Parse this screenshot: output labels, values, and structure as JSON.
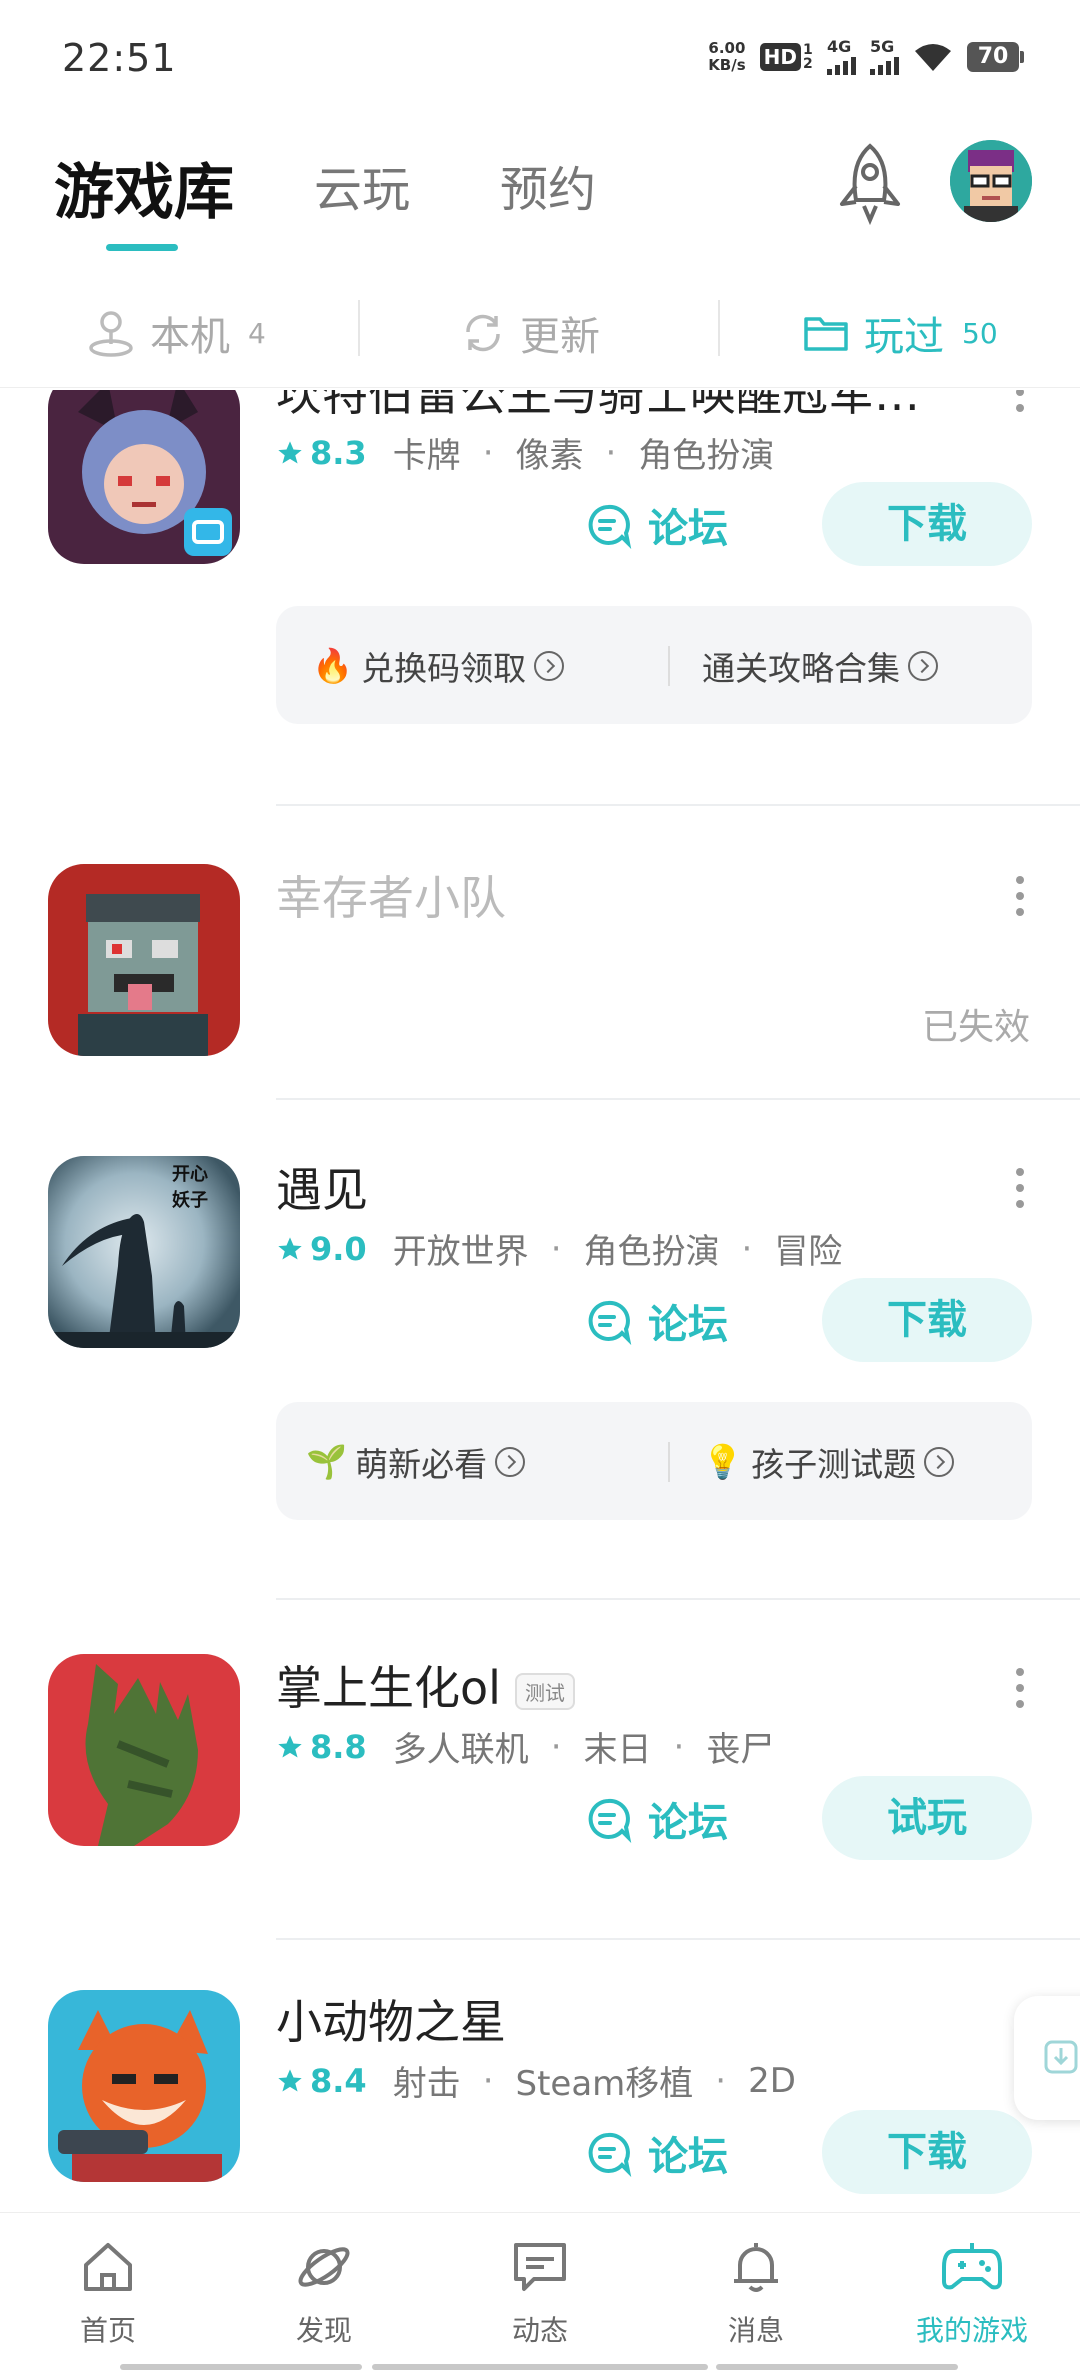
{
  "status_bar": {
    "time": "22:51",
    "net_speed_value": "6.00",
    "net_speed_unit": "KB/s",
    "hd_label": "HD",
    "hd_sims": "1 2",
    "sig1_label": "4G",
    "sig2_label": "5G",
    "battery": "70"
  },
  "header": {
    "tabs": [
      {
        "label": "游戏库",
        "active": true
      },
      {
        "label": "云玩",
        "active": false
      },
      {
        "label": "预约",
        "active": false
      }
    ],
    "icons": [
      "rocket-icon",
      "avatar"
    ]
  },
  "subtabs": [
    {
      "label": "本机",
      "count": "4",
      "icon": "person-pin-icon"
    },
    {
      "label": "更新",
      "count": "",
      "icon": "refresh-icon"
    },
    {
      "label": "玩过",
      "count": "50",
      "icon": "folder-icon",
      "active": true
    }
  ],
  "games": [
    {
      "title": "坎特伯雷公主与骑士唤醒冠军…",
      "rating": "8.3",
      "tags": [
        "卡牌",
        "像素",
        "角色扮演"
      ],
      "forum_label": "论坛",
      "action_label": "下载",
      "extras": [
        {
          "label": "兑换码领取",
          "emoji": "🔥"
        },
        {
          "label": "通关攻略合集",
          "emoji": ""
        }
      ]
    },
    {
      "title": "幸存者小队",
      "status": "已失效"
    },
    {
      "title": "遇见",
      "rating": "9.0",
      "tags": [
        "开放世界",
        "角色扮演",
        "冒险"
      ],
      "forum_label": "论坛",
      "action_label": "下载",
      "icon_text": "开心 妖子",
      "extras": [
        {
          "label": "萌新必看",
          "emoji": "🌱"
        },
        {
          "label": "孩子测试题",
          "emoji": "💡"
        }
      ]
    },
    {
      "title": "掌上生化ol",
      "badge": "测试",
      "rating": "8.8",
      "tags": [
        "多人联机",
        "末日",
        "丧尸"
      ],
      "forum_label": "论坛",
      "action_label": "试玩"
    },
    {
      "title": "小动物之星",
      "rating": "8.4",
      "tags": [
        "射击",
        "Steam移植",
        "2D"
      ],
      "forum_label": "论坛",
      "action_label": "下载"
    }
  ],
  "bottom_nav": [
    {
      "label": "首页",
      "icon": "home-icon"
    },
    {
      "label": "发现",
      "icon": "planet-icon"
    },
    {
      "label": "动态",
      "icon": "chat-icon"
    },
    {
      "label": "消息",
      "icon": "bell-icon"
    },
    {
      "label": "我的游戏",
      "icon": "gamepad-icon",
      "active": true
    }
  ],
  "colors": {
    "accent": "#2bbdc0",
    "accent_bg": "#e6f7f7"
  }
}
